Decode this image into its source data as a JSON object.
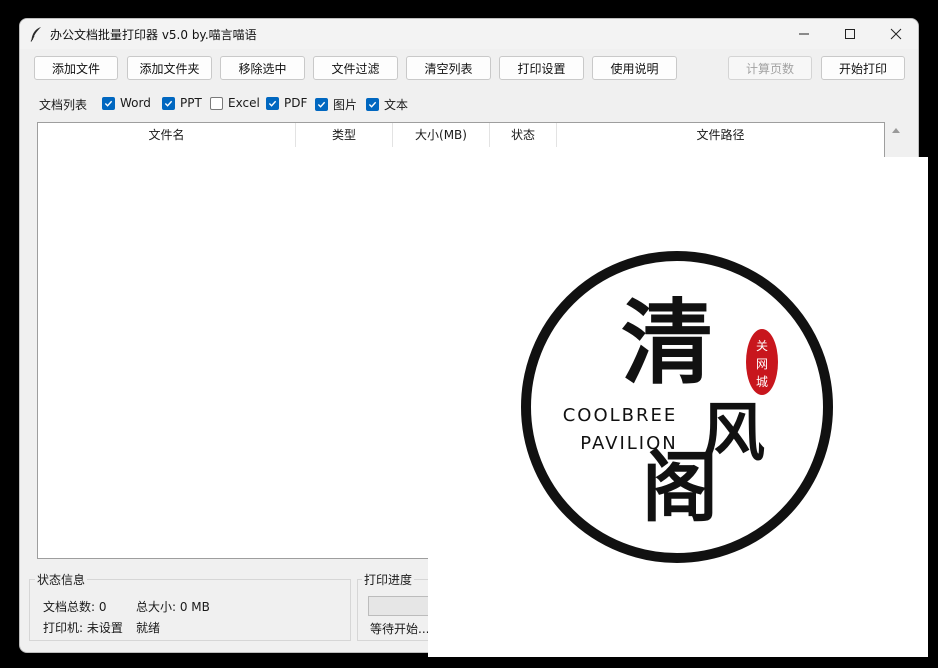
{
  "window": {
    "title": "办公文档批量打印器 v5.0 by.喵言喵语"
  },
  "toolbar": {
    "add_file": "添加文件",
    "add_folder": "添加文件夹",
    "remove_selected": "移除选中",
    "file_filter": "文件过滤",
    "clear_list": "清空列表",
    "print_settings": "打印设置",
    "help": "使用说明",
    "count_pages": "计算页数",
    "start_print": "开始打印"
  },
  "filters": {
    "label": "文档列表",
    "items": [
      {
        "label": "Word",
        "checked": true
      },
      {
        "label": "PPT",
        "checked": true
      },
      {
        "label": "Excel",
        "checked": false
      },
      {
        "label": "PDF",
        "checked": true
      },
      {
        "label": "图片",
        "checked": true
      },
      {
        "label": "文本",
        "checked": true
      }
    ]
  },
  "table": {
    "columns": [
      "文件名",
      "类型",
      "大小(MB)",
      "状态",
      "文件路径"
    ],
    "rows": []
  },
  "status": {
    "group_title": "状态信息",
    "total_docs": "文档总数: 0",
    "total_size": "总大小: 0 MB",
    "printer": "打印机: 未设置",
    "state": "就绪"
  },
  "progress": {
    "group_title": "打印进度",
    "text": "等待开始...",
    "value": 0
  },
  "logo": {
    "char1": "清",
    "char2": "风",
    "char3": "阁",
    "en_line1": "COOLBREE",
    "en_line2": "PAVILION",
    "seal_chars": [
      "关",
      "网",
      "城"
    ]
  },
  "colors": {
    "accent": "#0067c0",
    "seal": "#c8161d",
    "logo_ink": "#111111"
  }
}
